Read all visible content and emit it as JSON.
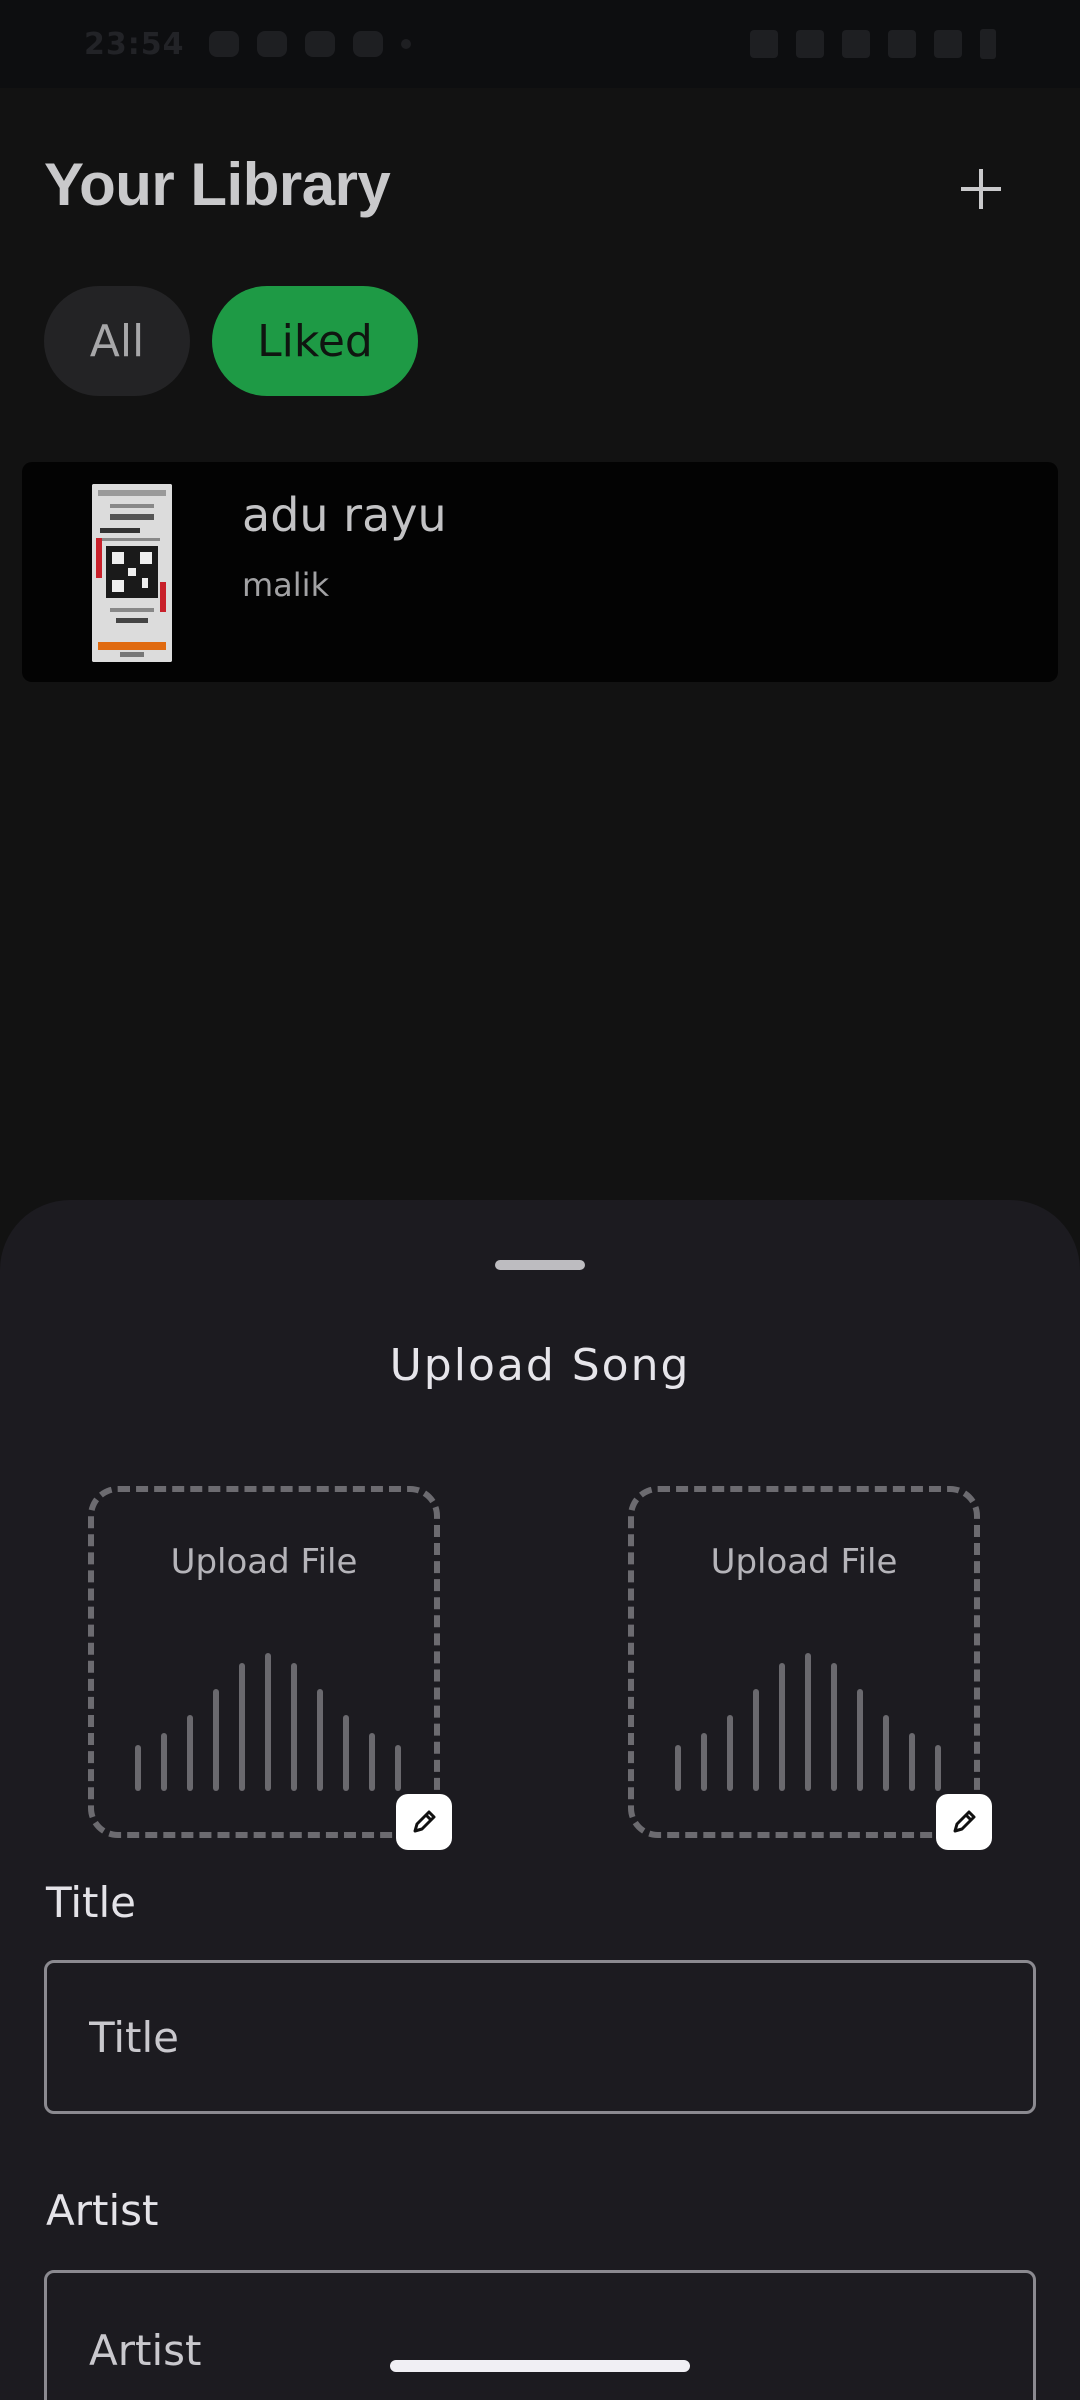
{
  "status_bar": {
    "time": "23:54"
  },
  "library": {
    "title": "Your Library",
    "add_icon": "plus-icon",
    "filters": [
      {
        "label": "All",
        "selected": false
      },
      {
        "label": "Liked",
        "selected": true
      }
    ],
    "songs": [
      {
        "title": "adu rayu",
        "artist": "malik"
      }
    ]
  },
  "upload_sheet": {
    "title": "Upload Song",
    "upload_boxes": [
      {
        "label": "Upload File",
        "icon": "pencil-icon"
      },
      {
        "label": "Upload File",
        "icon": "pencil-icon"
      }
    ],
    "fields": {
      "title": {
        "label": "Title",
        "placeholder": "Title"
      },
      "artist": {
        "label": "Artist",
        "placeholder": "Artist"
      }
    }
  },
  "colors": {
    "accent_green": "#1e9a45",
    "sheet_background": "#1c1b20",
    "page_background": "#121212"
  }
}
